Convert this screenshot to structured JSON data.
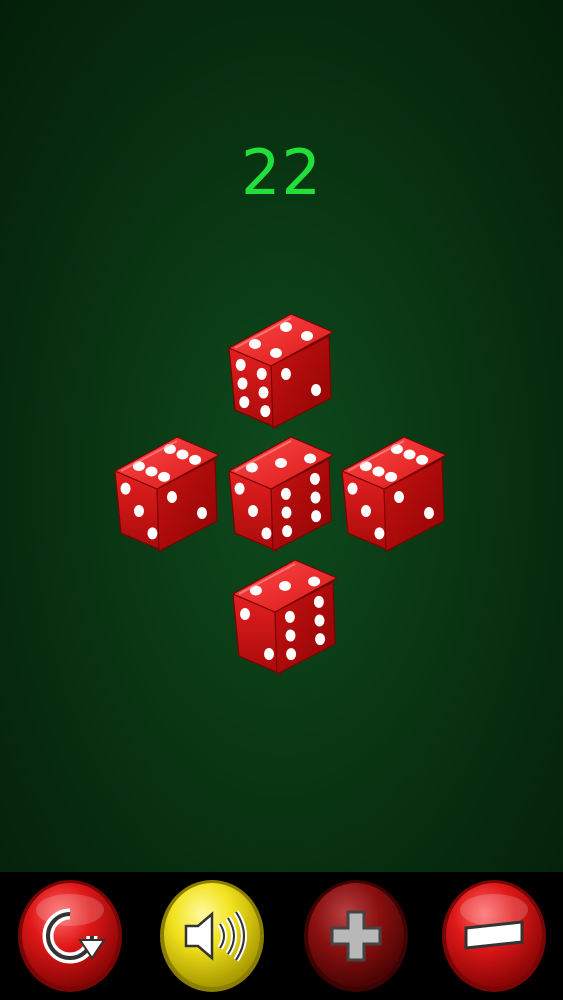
{
  "score": "22",
  "dice": [
    {
      "id": "top",
      "top_face": 4,
      "left_face": 6,
      "right_face": 2
    },
    {
      "id": "left",
      "top_face": 6,
      "left_face": 3,
      "right_face": 2
    },
    {
      "id": "center",
      "top_face": 3,
      "left_face": 3,
      "right_face": 6
    },
    {
      "id": "right",
      "top_face": 6,
      "left_face": 3,
      "right_face": 2
    },
    {
      "id": "bottom",
      "top_face": 3,
      "left_face": 2,
      "right_face": 6
    }
  ],
  "toolbar": {
    "buttons": [
      {
        "name": "reroll",
        "icon": "rotate-icon",
        "color": "#e01818"
      },
      {
        "name": "sound",
        "icon": "speaker-icon",
        "color": "#f2e21c"
      },
      {
        "name": "add-die",
        "icon": "plus-icon",
        "color": "#8a1010",
        "state": "disabled"
      },
      {
        "name": "remove-die",
        "icon": "minus-icon",
        "color": "#e01818"
      }
    ]
  },
  "colors": {
    "score": "#22e03a",
    "felt": "#0a3a15",
    "die": "#d91a1a"
  }
}
